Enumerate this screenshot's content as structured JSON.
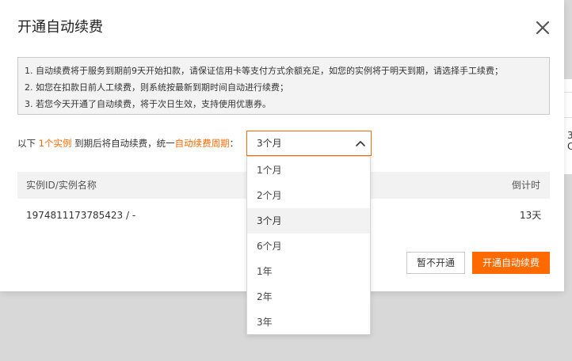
{
  "dialog": {
    "title": "开通自动续费"
  },
  "notice": {
    "lines": [
      "1. 自动续费将于服务到期前9天开始扣款，请保证信用卡等支付方式余额充足，如您的实例将于明天到期，请选择手工续费；",
      "2. 如您在扣款日前人工续费，则系统按最新到期时间自动进行续费；",
      "3. 若您今天开通了自动续费，将于次日生效，支持使用优惠券。"
    ]
  },
  "sentence": {
    "prefix": "以下 ",
    "count_link": "1个实例",
    "middle": " 到期后将自动续费，统一",
    "period_label": "自动续费周期",
    "colon": "："
  },
  "period_select": {
    "selected": "3个月",
    "options": [
      "1个月",
      "2个月",
      "3个月",
      "6个月",
      "1年",
      "2年",
      "3年"
    ]
  },
  "table": {
    "headers": [
      "实例ID/实例名称",
      "倒计时"
    ],
    "rows": [
      [
        "1974811173785423 / -",
        "13天"
      ]
    ]
  },
  "buttons": {
    "cancel": "暂不开通",
    "confirm": "开通自动续费"
  },
  "background_peek": {
    "chars": [
      "3",
      "C"
    ]
  },
  "colors": {
    "accent": "#ff6a00",
    "notice_bg": "#f3f3f3",
    "header_bg": "#f2f2f2",
    "backdrop": "#d8d8d8"
  }
}
